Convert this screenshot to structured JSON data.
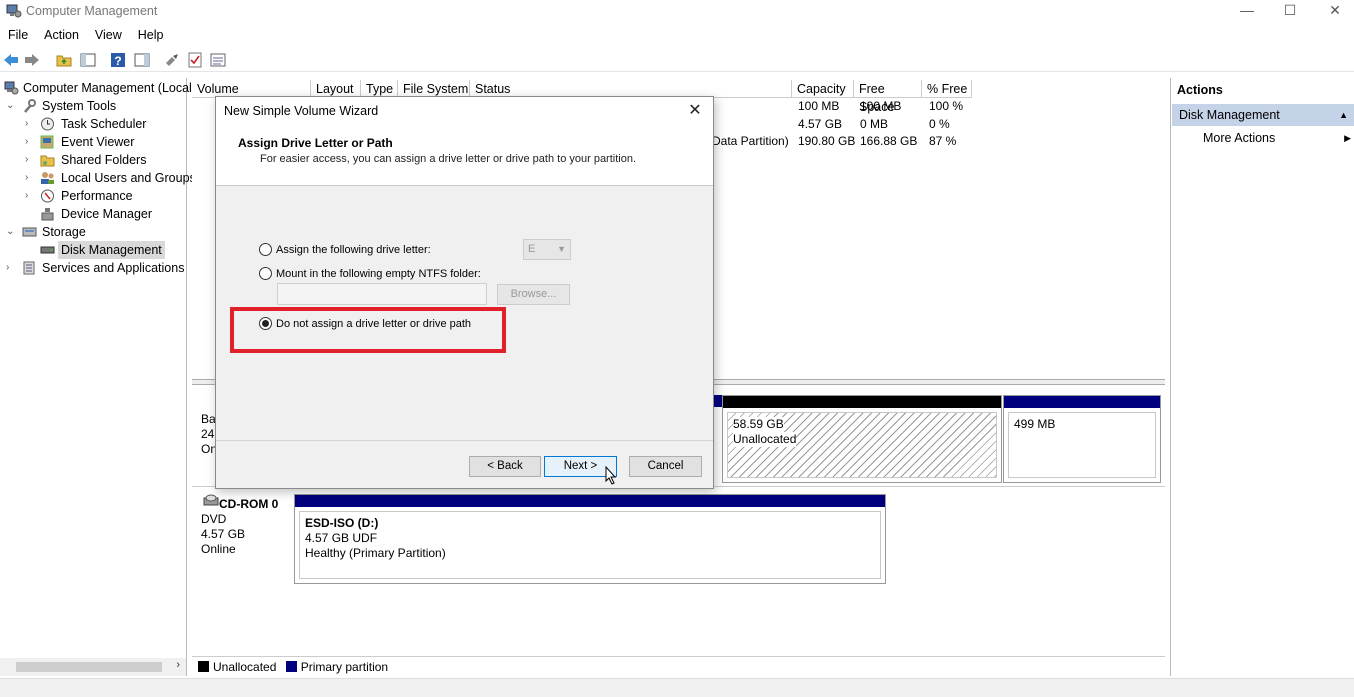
{
  "window": {
    "title": "Computer Management",
    "minimize": "—",
    "maximize": "☐",
    "close": "✕"
  },
  "menu": [
    "File",
    "Action",
    "View",
    "Help"
  ],
  "tree": {
    "root": "Computer Management (Local",
    "system_tools": "System Tools",
    "task_scheduler": "Task Scheduler",
    "event_viewer": "Event Viewer",
    "shared_folders": "Shared Folders",
    "local_users": "Local Users and Groups",
    "performance": "Performance",
    "device_manager": "Device Manager",
    "storage": "Storage",
    "disk_management": "Disk Management",
    "services": "Services and Applications"
  },
  "volume_list": {
    "columns": [
      "Volume",
      "Layout",
      "Type",
      "File System",
      "Status",
      "Capacity",
      "Free Space",
      "% Free"
    ],
    "rows": [
      {
        "status_tail": "",
        "capacity": "100 MB",
        "free": "100 MB",
        "pct": "100 %"
      },
      {
        "status_tail": "",
        "capacity": "4.57 GB",
        "free": "0 MB",
        "pct": "0 %"
      },
      {
        "status_tail": "Data Partition)",
        "capacity": "190.80 GB",
        "free": "166.88 GB",
        "pct": "87 %"
      }
    ]
  },
  "disk0": {
    "label_partial": [
      "Ba",
      "24",
      "On"
    ],
    "unallocated_size": "58.59 GB",
    "unallocated_label": "Unallocated",
    "last_part_size": "499 MB"
  },
  "cdrom": {
    "name": "CD-ROM 0",
    "type": "DVD",
    "size": "4.57 GB",
    "status": "Online",
    "vol_name": "ESD-ISO  (D:)",
    "vol_fs": "4.57 GB UDF",
    "vol_status": "Healthy (Primary Partition)"
  },
  "legend": {
    "unallocated": "Unallocated",
    "primary": "Primary partition"
  },
  "actions": {
    "header": "Actions",
    "section": "Disk Management",
    "more": "More Actions"
  },
  "dialog": {
    "title": "New Simple Volume Wizard",
    "close": "✕",
    "heading": "Assign Drive Letter or Path",
    "subheading": "For easier access, you can assign a drive letter or drive path to your partition.",
    "opt_letter": "Assign the following drive letter:",
    "drive_letter": "E",
    "opt_folder": "Mount in the following empty NTFS folder:",
    "browse": "Browse...",
    "opt_none": "Do not assign a drive letter or drive path",
    "back": "< Back",
    "next": "Next >",
    "cancel": "Cancel"
  },
  "colors": {
    "primary_partition": "#00007f",
    "unallocated": "#000000",
    "highlight": "#e0202a",
    "actions_section_bg": "#c5d3e8"
  }
}
